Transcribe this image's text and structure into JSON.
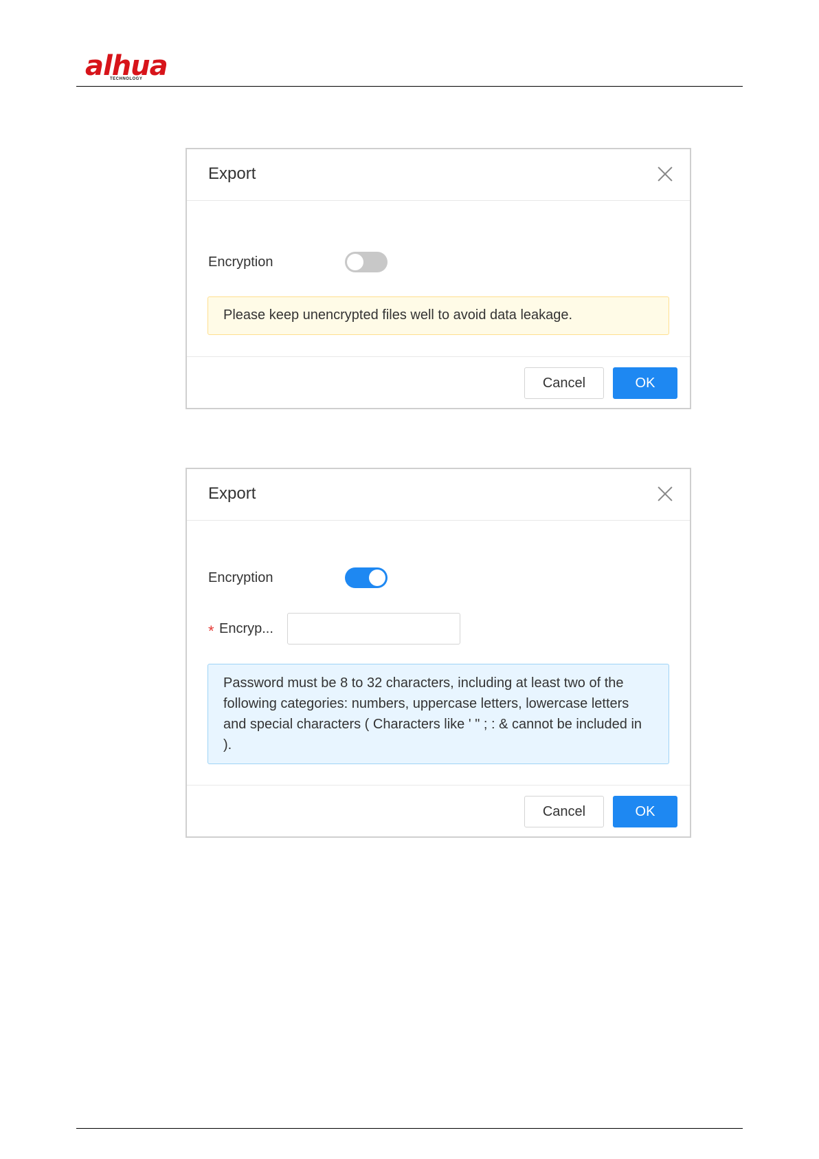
{
  "header": {
    "logo_text": "alhua",
    "logo_sub": "TECHNOLOGY",
    "brand_color": "#d7141a"
  },
  "dialog1": {
    "title": "Export",
    "encryption_label": "Encryption",
    "encryption_enabled": false,
    "notice": "Please keep unencrypted files well to avoid data leakage.",
    "cancel_label": "Cancel",
    "ok_label": "OK"
  },
  "dialog2": {
    "title": "Export",
    "encryption_label": "Encryption",
    "encryption_enabled": true,
    "required_mark": "*",
    "password_label": "Encryp...",
    "password_value": "",
    "notice": "Password must be 8 to 32 characters, including at least two of the following categories: numbers, uppercase letters, lowercase letters and special characters ( Characters like ' \" ; : & cannot be included in ).",
    "cancel_label": "Cancel",
    "ok_label": "OK"
  },
  "colors": {
    "accent": "#1e88f2",
    "warn_bg": "#fffbe7",
    "info_bg": "#e8f5ff"
  }
}
